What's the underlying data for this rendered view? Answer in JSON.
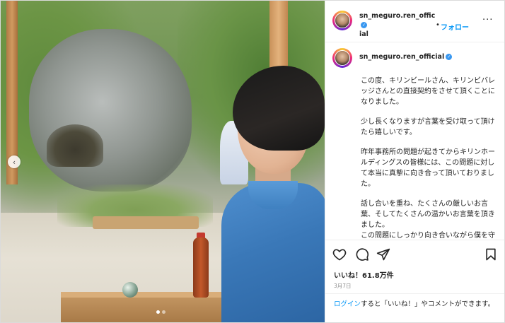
{
  "post": {
    "username": "sn_meguro.ren_official",
    "username_wrapped_line1": "sn_meguro.ren_offic",
    "username_wrapped_line2": "ial",
    "follow_label": "フォロー",
    "follow_separator": "•",
    "more_label": "···",
    "caption_paragraphs": [
      "この度、キリンビールさん、キリンビバレッジさんとの直接契約をさせて頂くことになりました。",
      "少し長くなりますが言葉を受け取って頂けたら嬉しいです。",
      "昨年事務所の問題が起きてからキリンホールディングスの皆様には、この問題に対して本当に真摯に向き合って頂いておりました。",
      "話し合いを重ね、たくさんの厳しいお言葉、そしてたくさんの温かいお言葉を頂きました。",
      "この問題にしっかり向き合いながら僕を守ってくれて、たくさん寄り添って"
    ],
    "likes_label": "いいね！61.8万件",
    "date": "3月7日",
    "login_link": "ログイン",
    "login_rest": "すると「いいね！」やコメントができます。"
  },
  "icons": {
    "heart": "heart-icon",
    "comment": "comment-icon",
    "share": "share-icon",
    "bookmark": "bookmark-icon",
    "verified": "verified-badge-icon",
    "carousel_prev": "chevron-left-icon"
  },
  "colors": {
    "accent": "#0095f6",
    "verified": "#3897f0",
    "text": "#262626",
    "muted": "#8e8e8e"
  },
  "carousel": {
    "count": 2,
    "active": 1
  }
}
